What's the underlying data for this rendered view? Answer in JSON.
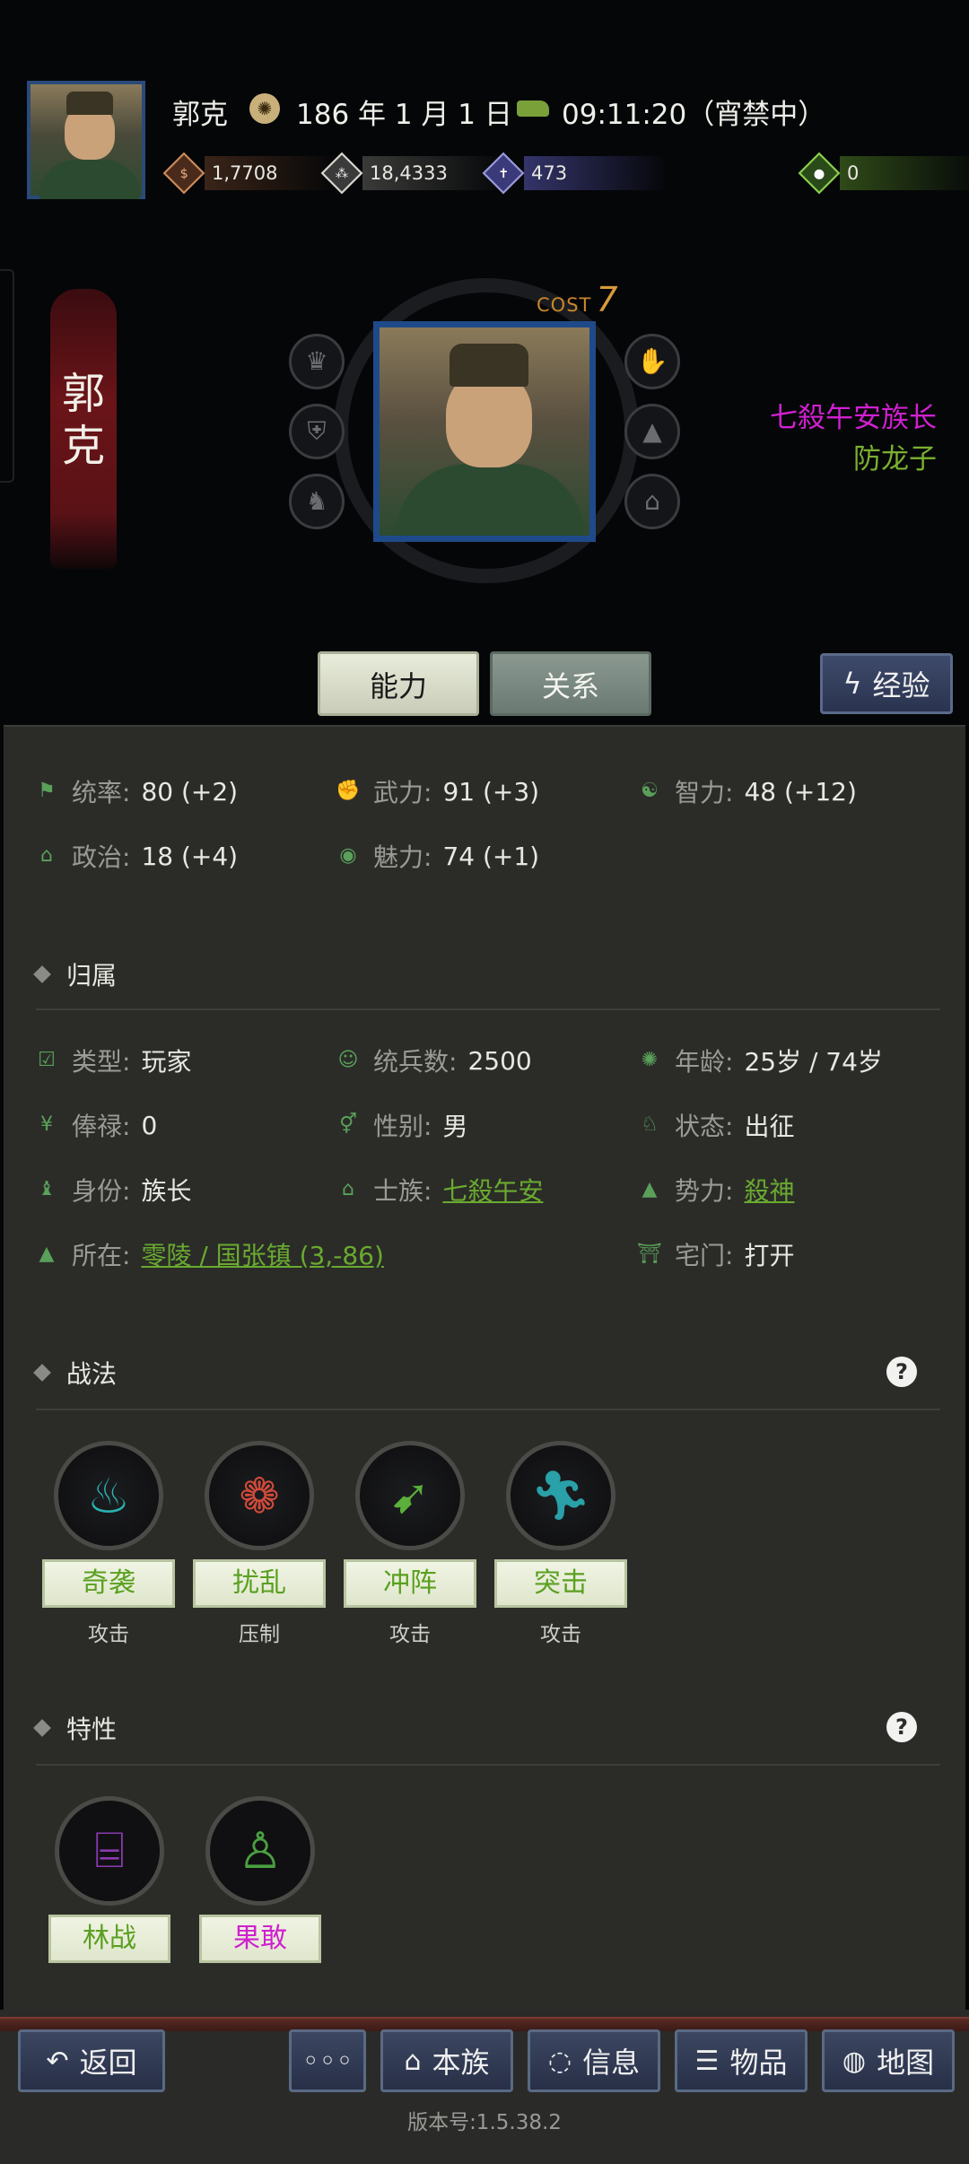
{
  "header": {
    "name": "郭克",
    "date": "186 年 1 月 1 日",
    "time": "09:11:20（宵禁中）",
    "resources": {
      "coin": "1,7708",
      "grain": "18,4333",
      "soldiers": "473",
      "bag": "0"
    }
  },
  "character": {
    "banner_name_1": "郭",
    "banner_name_2": "克",
    "cost_label": "COST",
    "cost_value": "7",
    "title_primary": "七殺午安族长",
    "title_secondary": "防龙子",
    "colors": {
      "title_primary": "#d020d0",
      "title_secondary": "#7ab030"
    }
  },
  "tabs": {
    "ability": "能力",
    "relation": "关系",
    "experience": "经验"
  },
  "stats": {
    "command_k": "统率:",
    "command_v": "80 (+2)",
    "force_k": "武力:",
    "force_v": "91 (+3)",
    "intellect_k": "智力:",
    "intellect_v": "48 (+12)",
    "politics_k": "政治:",
    "politics_v": "18 (+4)",
    "charm_k": "魅力:",
    "charm_v": "74 (+1)"
  },
  "affiliation": {
    "section_title": "归属",
    "type_k": "类型:",
    "type_v": "玩家",
    "troops_k": "统兵数:",
    "troops_v": "2500",
    "age_k": "年龄:",
    "age_v": "25岁 / 74岁",
    "salary_k": "俸禄:",
    "salary_v": "0",
    "gender_k": "性别:",
    "gender_v": "男",
    "status_k": "状态:",
    "status_v": "出征",
    "identity_k": "身份:",
    "identity_v": "族长",
    "clan_k": "士族:",
    "clan_v": "七殺午安",
    "faction_k": "势力:",
    "faction_v": "殺神",
    "location_k": "所在:",
    "location_v": "零陵 / 国张镇 (3,-86)",
    "gate_k": "宅门:",
    "gate_v": "打开"
  },
  "tactics": {
    "section_title": "战法",
    "items": [
      {
        "name": "奇袭",
        "type": "攻击",
        "icon": "blue-flame-icon"
      },
      {
        "name": "扰乱",
        "type": "压制",
        "icon": "red-cloud-icon"
      },
      {
        "name": "冲阵",
        "type": "攻击",
        "icon": "green-arrows-icon"
      },
      {
        "name": "突击",
        "type": "攻击",
        "icon": "running-soldier-icon"
      }
    ]
  },
  "traits": {
    "section_title": "特性",
    "items": [
      {
        "name": "林战",
        "icon": "forest-icon",
        "color": "#5aa020"
      },
      {
        "name": "果敢",
        "icon": "strongman-icon",
        "color": "#d020d0"
      }
    ]
  },
  "bottom_nav": {
    "back": "返回",
    "more": "◦◦◦",
    "clan": "本族",
    "info": "信息",
    "items": "物品",
    "map": "地图"
  },
  "version": "版本号:1.5.38.2"
}
